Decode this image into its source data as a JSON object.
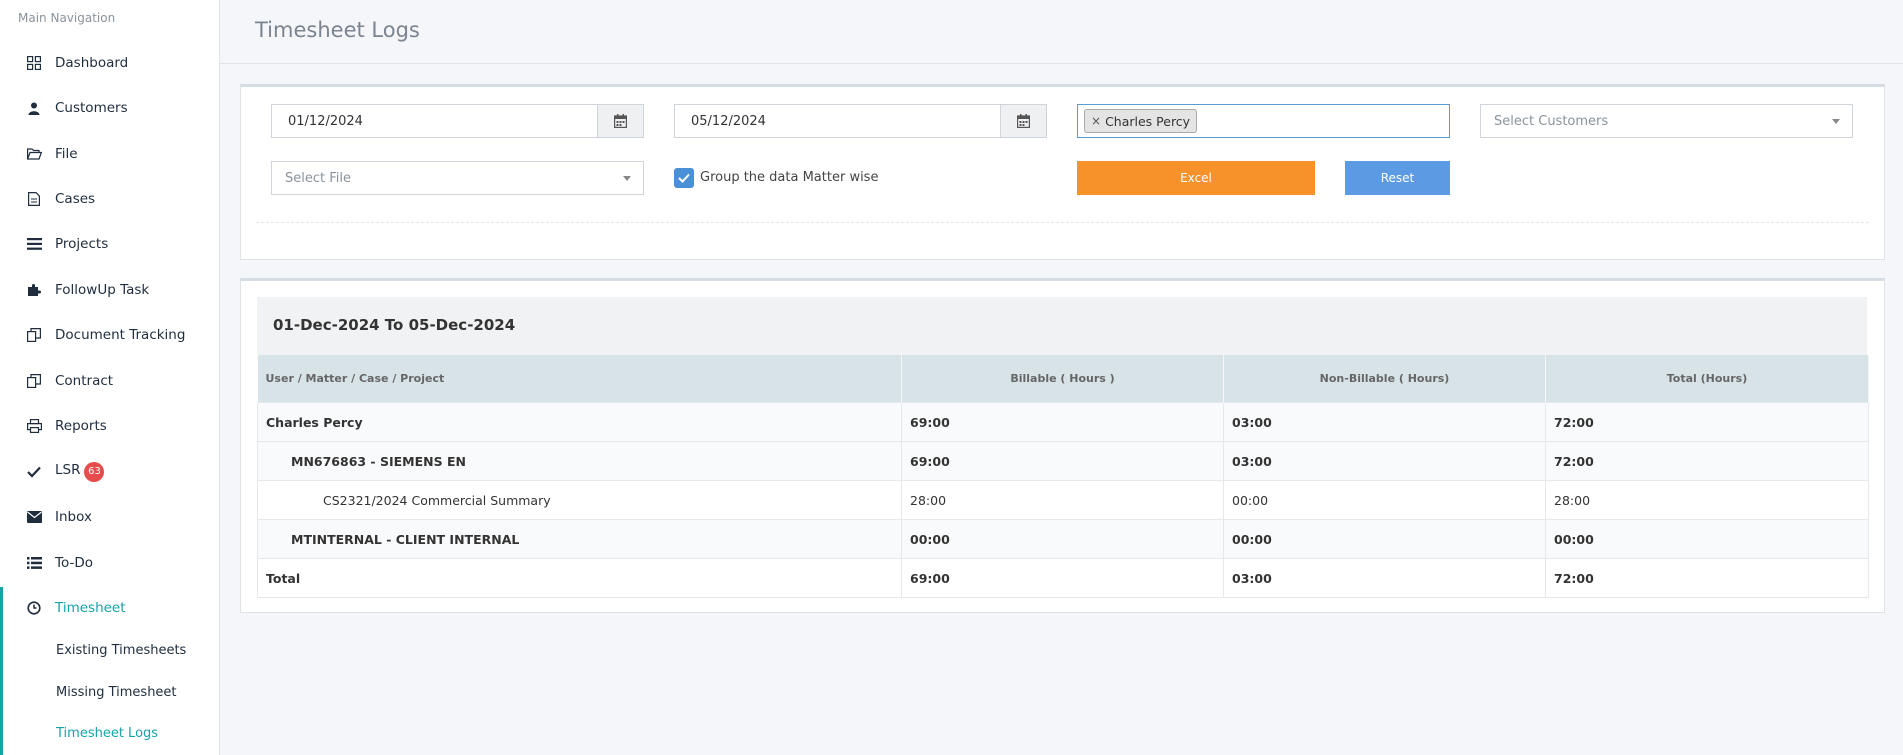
{
  "sidebar": {
    "heading": "Main Navigation",
    "items": [
      {
        "label": "Dashboard",
        "icon": "grid-icon"
      },
      {
        "label": "Customers",
        "icon": "user-icon"
      },
      {
        "label": "File",
        "icon": "folder-open-icon"
      },
      {
        "label": "Cases",
        "icon": "document-icon"
      },
      {
        "label": "Projects",
        "icon": "list-icon"
      },
      {
        "label": "FollowUp Task",
        "icon": "puzzle-icon"
      },
      {
        "label": "Document Tracking",
        "icon": "copy-icon"
      },
      {
        "label": "Contract",
        "icon": "copy-icon"
      },
      {
        "label": "Reports",
        "icon": "printer-icon"
      },
      {
        "label": "LSR",
        "icon": "check-icon",
        "badge": "63"
      },
      {
        "label": "Inbox",
        "icon": "envelope-icon"
      },
      {
        "label": "To-Do",
        "icon": "list-icon"
      },
      {
        "label": "Timesheet",
        "icon": "clock-icon",
        "active": true
      }
    ],
    "sub_items": [
      {
        "label": "Existing Timesheets"
      },
      {
        "label": "Missing Timesheet"
      },
      {
        "label": "Timesheet Logs",
        "active": true
      }
    ],
    "accent_color": "#17a2a8"
  },
  "header": {
    "title": "Timesheet Logs"
  },
  "filters": {
    "from_date": "01/12/2024",
    "to_date": "05/12/2024",
    "selected_user": "Charles Percy",
    "customers_placeholder": "Select Customers",
    "file_placeholder": "Select File",
    "group_checkbox_label": "Group the data Matter wise",
    "group_checked": true,
    "excel_label": "Excel",
    "reset_label": "Reset",
    "excel_color": "#f7912a",
    "reset_color": "#5c9be4"
  },
  "report": {
    "range_title": "01-Dec-2024 To 05-Dec-2024",
    "columns": [
      "User / Matter / Case / Project",
      "Billable ( Hours )",
      "Non-Billable ( Hours)",
      "Total (Hours)"
    ],
    "rows": [
      {
        "label": "Charles Percy",
        "billable": "69:00",
        "non_billable": "03:00",
        "total": "72:00"
      },
      {
        "label": "MN676863 - SIEMENS EN",
        "billable": "69:00",
        "non_billable": "03:00",
        "total": "72:00"
      },
      {
        "label": "CS2321/2024 Commercial Summary",
        "billable": "28:00",
        "non_billable": "00:00",
        "total": "28:00"
      },
      {
        "label": "MTINTERNAL - CLIENT INTERNAL",
        "billable": "00:00",
        "non_billable": "00:00",
        "total": "00:00"
      },
      {
        "label": "Total",
        "billable": "69:00",
        "non_billable": "03:00",
        "total": "72:00"
      }
    ]
  }
}
